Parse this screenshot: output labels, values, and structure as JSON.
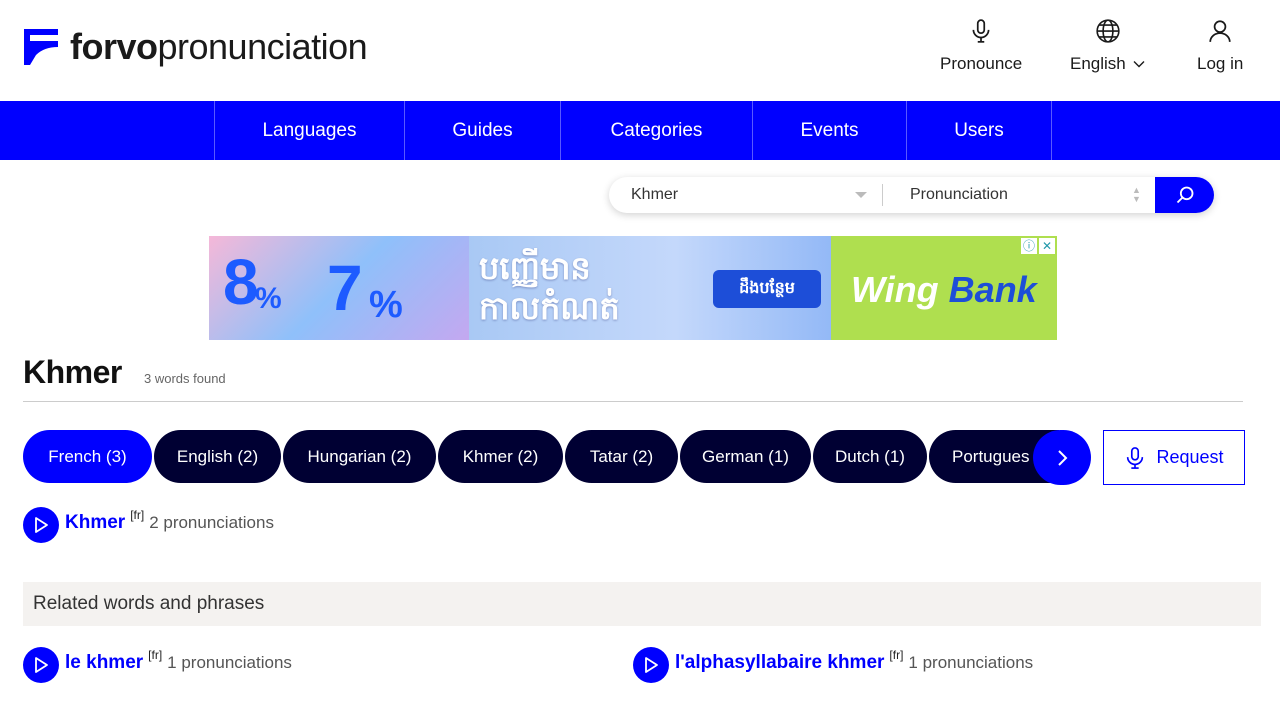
{
  "header": {
    "logo_bold": "forvo",
    "logo_light": "pronunciation",
    "actions": [
      {
        "label": "Pronounce",
        "icon": "microphone-icon"
      },
      {
        "label": "English",
        "icon": "globe-icon"
      },
      {
        "label": "Log in",
        "icon": "user-icon"
      }
    ]
  },
  "nav": {
    "items": [
      "Languages",
      "Guides",
      "Categories",
      "Events",
      "Users"
    ]
  },
  "search": {
    "language": "Khmer",
    "type": "Pronunciation"
  },
  "ad": {
    "num1": "8",
    "num2": "7",
    "percent": "%",
    "khmer_line1": "បញ្ញើមាន",
    "khmer_line2": "កាលកំណត់",
    "badge": "ដឹងបន្ថែម",
    "brand_a": "Wing",
    "brand_b": "Bank"
  },
  "results": {
    "title": "Khmer",
    "count": "3 words found"
  },
  "pills": [
    {
      "label": "French (3)",
      "active": true
    },
    {
      "label": "English (2)",
      "active": false
    },
    {
      "label": "Hungarian (2)",
      "active": false
    },
    {
      "label": "Khmer (2)",
      "active": false
    },
    {
      "label": "Tatar (2)",
      "active": false
    },
    {
      "label": "German (1)",
      "active": false
    },
    {
      "label": "Dutch (1)",
      "active": false
    },
    {
      "label": "Portugues",
      "active": false
    }
  ],
  "request_label": "Request",
  "main_entry": {
    "word": "Khmer",
    "lang": "[fr]",
    "count": "2 pronunciations"
  },
  "related": {
    "heading": "Related words and phrases",
    "items": [
      {
        "word": "le khmer",
        "lang": "[fr]",
        "count": "1 pronunciations"
      },
      {
        "word": "l'alphasyllabaire khmer",
        "lang": "[fr]",
        "count": "1 pronunciations"
      }
    ]
  },
  "colors": {
    "brand_blue": "#0000ff",
    "pill_dark": "#000033",
    "related_bg": "#f4f2f0"
  }
}
